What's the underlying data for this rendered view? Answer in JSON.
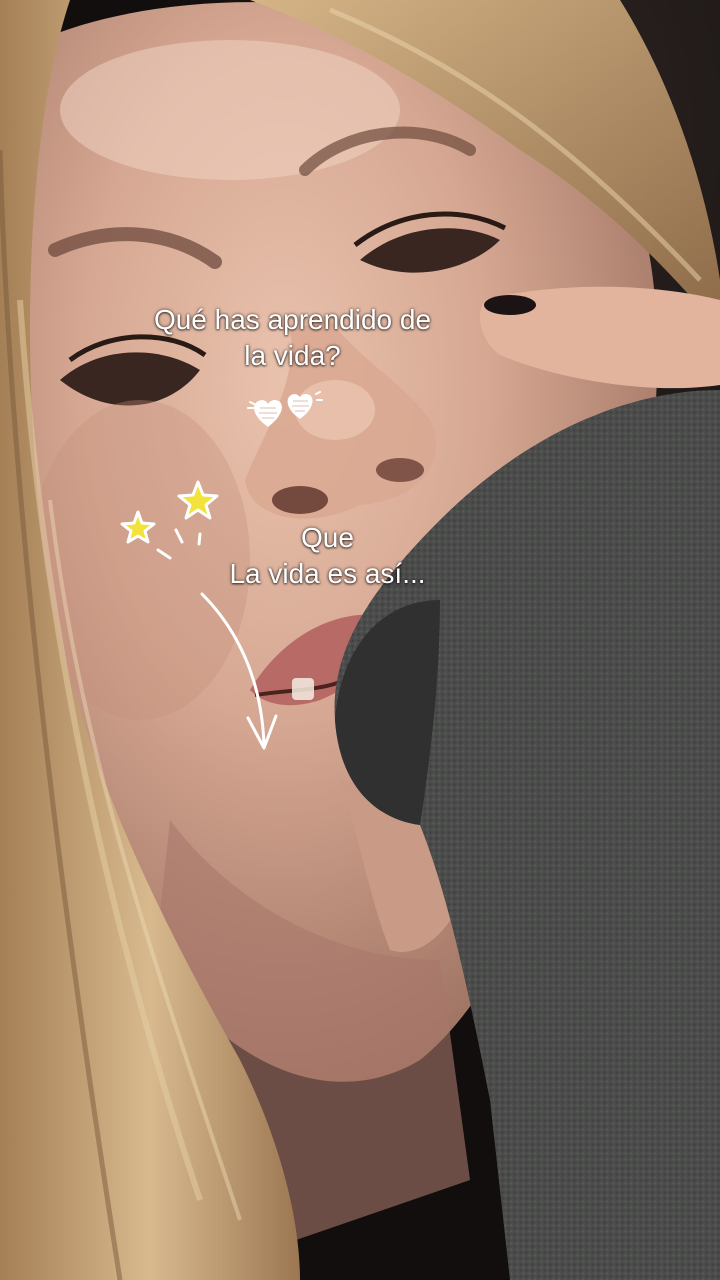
{
  "question": {
    "line1": "Qué has aprendido de",
    "line2": "la vida?"
  },
  "answer": {
    "line1": "Que",
    "line2": "La vida es así..."
  },
  "stickers": {
    "hearts": "hearts-doodle-icon",
    "stars": "stars-doodle-icon",
    "arrow": "curved-arrow-doodle-icon"
  },
  "colors": {
    "text": "#ffffff",
    "star_fill": "#f2e23a",
    "sweater": "#4a4b4a",
    "hair": "#c8a67a"
  }
}
